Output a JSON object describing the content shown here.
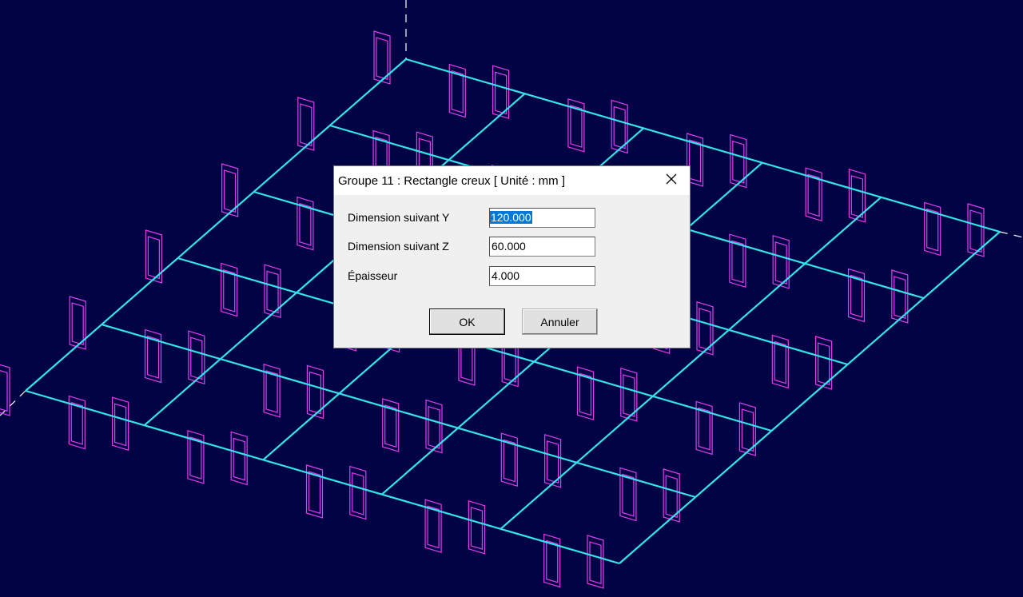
{
  "dialog": {
    "title": "Groupe 11 : Rectangle creux [ Unité :  mm ]",
    "close_icon": "close-icon",
    "fields": [
      {
        "label": "Dimension suivant Y",
        "value": "120.000",
        "selected": true
      },
      {
        "label": "Dimension suivant Z",
        "value": "60.000",
        "selected": false
      },
      {
        "label": "Épaisseur",
        "value": "4.000",
        "selected": false
      }
    ],
    "ok_label": "OK",
    "cancel_label": "Annuler"
  },
  "viewport": {
    "background": "#020344",
    "grid_color": "#33e3ee",
    "profile_color": "#e13cf0",
    "axis_color": "#ffffff"
  }
}
